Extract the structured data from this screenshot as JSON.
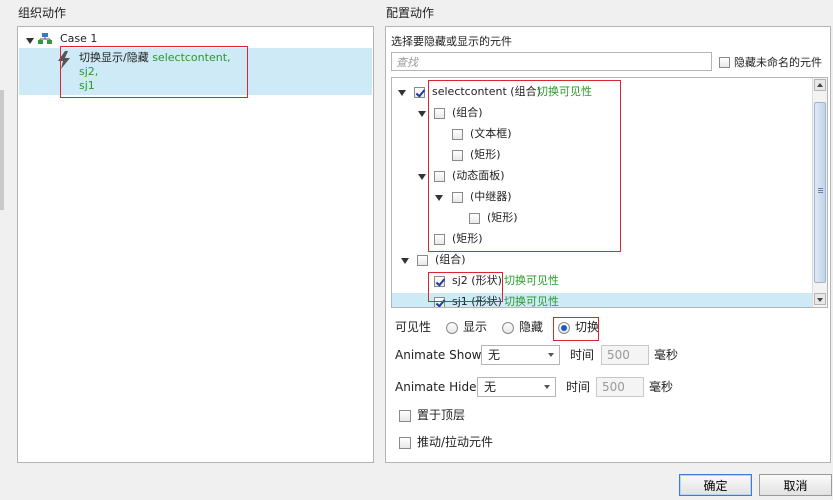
{
  "left": {
    "title": "组织动作",
    "case_label": "Case 1",
    "action": {
      "prefix": "切换显示/隐藏 ",
      "target1": "selectcontent,",
      "target2": "sj2,",
      "target3": "sj1"
    }
  },
  "right": {
    "title": "配置动作",
    "subtitle": "选择要隐藏或显示的元件",
    "search_placeholder": "查找",
    "hide_unnamed_label": "隐藏未命名的元件",
    "tree": [
      {
        "label": "selectcontent (组合)",
        "note": "切换可见性",
        "checked": true
      },
      {
        "label": "(组合)",
        "note": "",
        "checked": false
      },
      {
        "label": "(文本框)",
        "note": "",
        "checked": false
      },
      {
        "label": "(矩形)",
        "note": "",
        "checked": false
      },
      {
        "label": "(动态面板)",
        "note": "",
        "checked": false
      },
      {
        "label": "(中继器)",
        "note": "",
        "checked": false
      },
      {
        "label": "(矩形)",
        "note": "",
        "checked": false
      },
      {
        "label": "(矩形)",
        "note": "",
        "checked": false
      },
      {
        "label": "(组合)",
        "note": "",
        "checked": false
      },
      {
        "label": "sj2 (形状)",
        "note": "切换可见性",
        "checked": true
      },
      {
        "label": "sj1 (形状)",
        "note": "切换可见性",
        "checked": true
      }
    ],
    "visibility": {
      "label": "可见性",
      "options": [
        "显示",
        "隐藏",
        "切换"
      ],
      "selected": "切换"
    },
    "animate_show": {
      "label": "Animate Show",
      "value": "无",
      "time_label": "时间",
      "time_value": "500",
      "unit": "毫秒"
    },
    "animate_hide": {
      "label": "Animate Hide",
      "value": "无",
      "time_label": "时间",
      "time_value": "500",
      "unit": "毫秒"
    },
    "bring_to_front": "置于顶层",
    "push_pull": "推动/拉动元件"
  },
  "buttons": {
    "ok": "确定",
    "cancel": "取消"
  },
  "colors": {
    "selection": "#cdeaf6",
    "green_note": "#2a9a2a",
    "highlight_red": "#d9282d"
  }
}
